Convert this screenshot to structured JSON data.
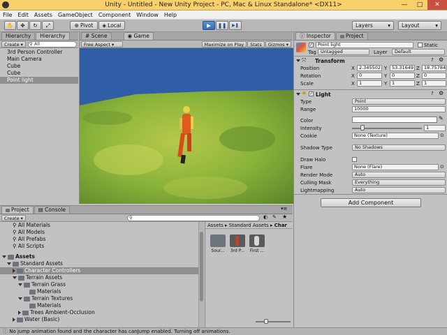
{
  "window": {
    "title": "Unity - Untitled - New Unity Project - PC, Mac & Linux Standalone* <DX11>",
    "minimize": "—",
    "maximize": "□",
    "close": "✕"
  },
  "menu": [
    "File",
    "Edit",
    "Assets",
    "GameObject",
    "Component",
    "Window",
    "Help"
  ],
  "toolbar": {
    "pivot": "Pivot",
    "local": "Local",
    "layers": "Layers",
    "layout": "Layout",
    "play": "▶",
    "pause": "❚❚",
    "step": "▶❚"
  },
  "hierarchy": {
    "tab_inactive": "Hierarchy",
    "tab_active": "Hierarchy",
    "create": "Create",
    "search": "All",
    "items": [
      "3rd Person Controller",
      "Main Camera",
      "Cube",
      "Cube",
      "Point light"
    ]
  },
  "scene": {
    "tab_scene": "Scene",
    "tab_game": "Game",
    "aspect": "Free Aspect",
    "maximize": "Maximize on Play",
    "stats": "Stats",
    "gizmos": "Gizmos"
  },
  "inspector": {
    "tab_inspector": "Inspector",
    "tab_project": "Project",
    "name": "Point light",
    "static": "Static",
    "tag_label": "Tag",
    "tag_value": "Untagged",
    "layer_label": "Layer",
    "layer_value": "Default",
    "transform": {
      "title": "Transform",
      "position_label": "Position",
      "rotation_label": "Rotation",
      "scale_label": "Scale",
      "position": {
        "x": "2.345502",
        "y": "53.31649",
        "z": "18.75784"
      },
      "rotation": {
        "x": "0",
        "y": "0",
        "z": "0"
      },
      "scale": {
        "x": "1",
        "y": "1",
        "z": "1"
      }
    },
    "light": {
      "title": "Light",
      "type_label": "Type",
      "type_value": "Point",
      "range_label": "Range",
      "range_value": "10000",
      "color_label": "Color",
      "intensity_label": "Intensity",
      "intensity_value": "1",
      "intensity_fraction": 0.125,
      "cookie_label": "Cookie",
      "cookie_value": "None (Texture)",
      "shadow_label": "Shadow Type",
      "shadow_value": "No Shadows",
      "drawhalo_label": "Draw Halo",
      "flare_label": "Flare",
      "flare_value": "None (Flare)",
      "render_label": "Render Mode",
      "render_value": "Auto",
      "culling_label": "Culling Mask",
      "culling_value": "Everything",
      "lightmap_label": "Lightmapping",
      "lightmap_value": "Auto"
    },
    "add_component": "Add Component"
  },
  "project": {
    "tab_project": "Project",
    "tab_console": "Console",
    "create": "Create",
    "favorites": [
      "All Materials",
      "All Models",
      "All Prefabs",
      "All Scripts"
    ],
    "tree": {
      "assets": "Assets",
      "standard": "Standard Assets",
      "char": "Character Controllers",
      "terrain": "Terrain Assets",
      "grass": "Terrain Grass",
      "grass_mat": "Materials",
      "textures": "Terrain Textures",
      "tex_mat": "Materials",
      "trees": "Trees Ambient-Occlusion",
      "water": "Water (Basic)"
    },
    "breadcrumb": [
      "Assets",
      "Standard Assets",
      "Char"
    ],
    "assets": [
      "Sour...",
      "3rd P...",
      "First ..."
    ]
  },
  "status": "No jump animation found and the character has canJump enabled. Turning off animations.",
  "colors": {
    "accent": "#3b6fb5",
    "sky": "#2f5ea6",
    "ground": "#8ab33a",
    "titlebar": "#f7d06c"
  }
}
